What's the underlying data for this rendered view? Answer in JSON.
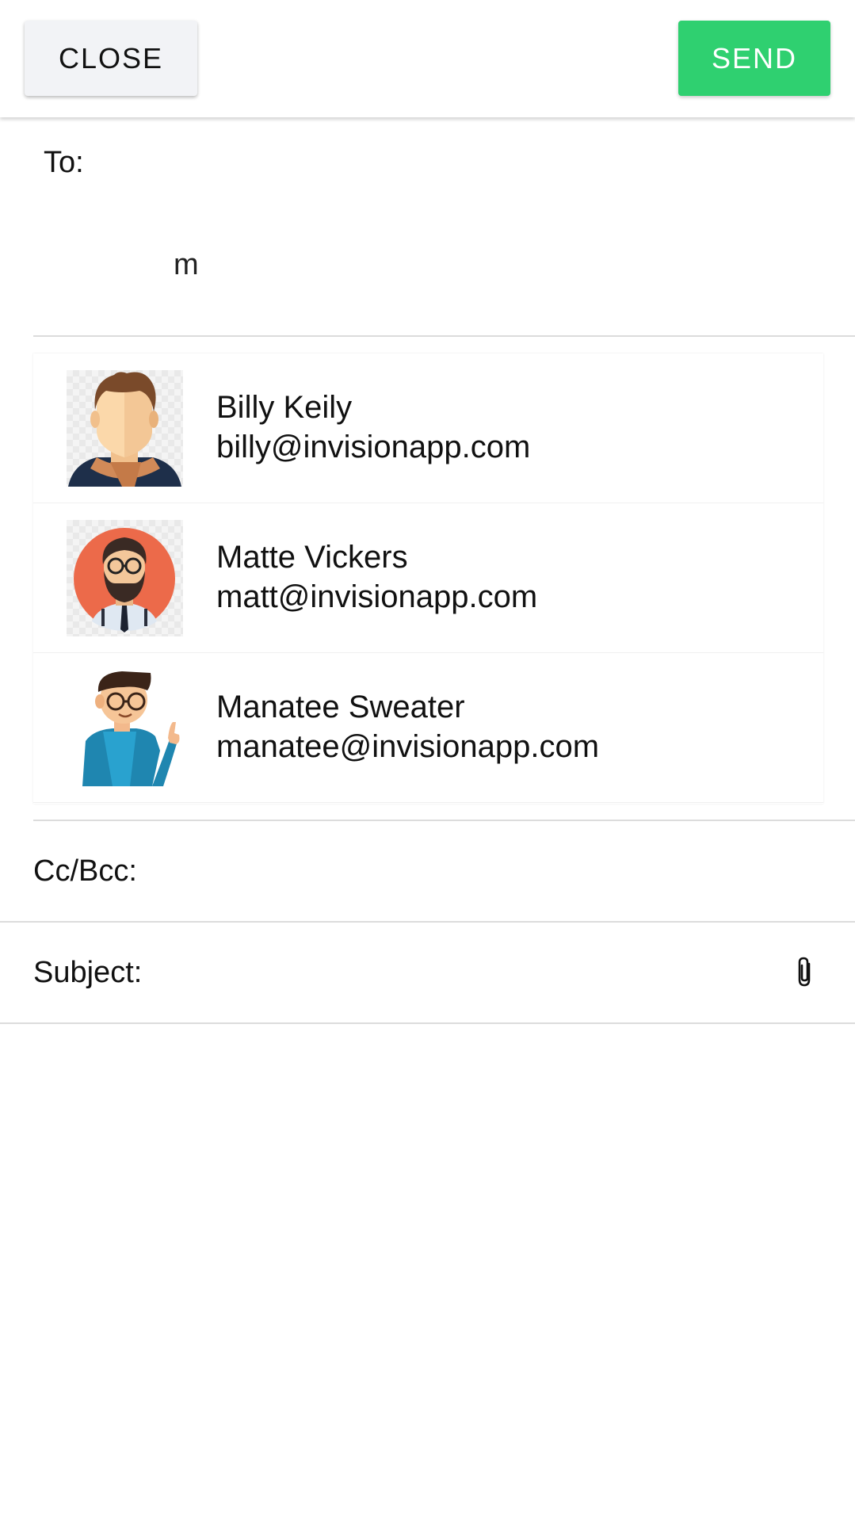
{
  "header": {
    "close_label": "CLOSE",
    "send_label": "SEND",
    "send_color": "#2fd070"
  },
  "to": {
    "label": "To:",
    "value": "m"
  },
  "suggestions": [
    {
      "name": "Billy Keily",
      "email": "billy@invisionapp.com",
      "avatar": "avatar-faceless-man"
    },
    {
      "name": "Matte Vickers",
      "email": "matt@invisionapp.com",
      "avatar": "avatar-bearded-man-glasses"
    },
    {
      "name": "Manatee Sweater",
      "email": "manatee@invisionapp.com",
      "avatar": "avatar-cartoon-man-pointing"
    }
  ],
  "ccbcc": {
    "label": "Cc/Bcc:",
    "value": ""
  },
  "subject": {
    "label": "Subject:",
    "value": "",
    "attach_icon": "paperclip-icon"
  },
  "body": {
    "value": ""
  }
}
